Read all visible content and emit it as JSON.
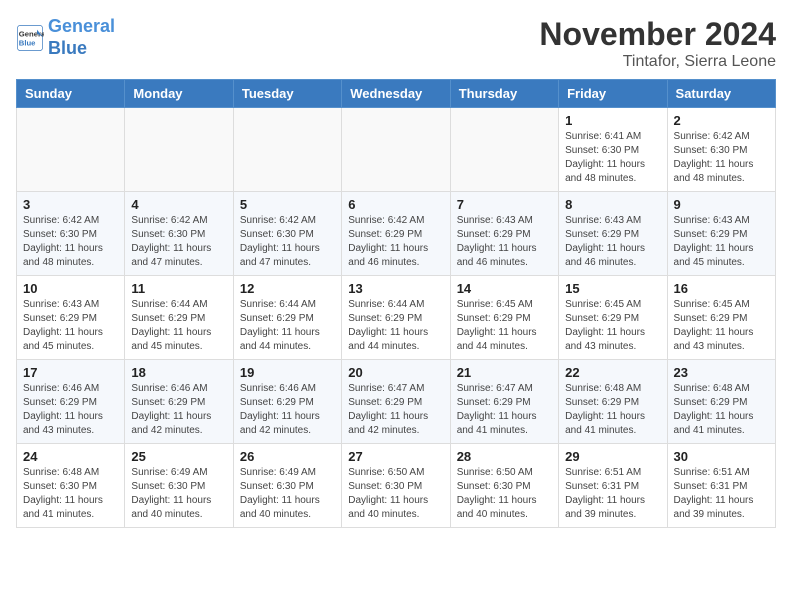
{
  "header": {
    "logo_line1": "General",
    "logo_line2": "Blue",
    "month_title": "November 2024",
    "location": "Tintafor, Sierra Leone"
  },
  "weekdays": [
    "Sunday",
    "Monday",
    "Tuesday",
    "Wednesday",
    "Thursday",
    "Friday",
    "Saturday"
  ],
  "weeks": [
    [
      {
        "day": "",
        "info": ""
      },
      {
        "day": "",
        "info": ""
      },
      {
        "day": "",
        "info": ""
      },
      {
        "day": "",
        "info": ""
      },
      {
        "day": "",
        "info": ""
      },
      {
        "day": "1",
        "info": "Sunrise: 6:41 AM\nSunset: 6:30 PM\nDaylight: 11 hours and 48 minutes."
      },
      {
        "day": "2",
        "info": "Sunrise: 6:42 AM\nSunset: 6:30 PM\nDaylight: 11 hours and 48 minutes."
      }
    ],
    [
      {
        "day": "3",
        "info": "Sunrise: 6:42 AM\nSunset: 6:30 PM\nDaylight: 11 hours and 48 minutes."
      },
      {
        "day": "4",
        "info": "Sunrise: 6:42 AM\nSunset: 6:30 PM\nDaylight: 11 hours and 47 minutes."
      },
      {
        "day": "5",
        "info": "Sunrise: 6:42 AM\nSunset: 6:30 PM\nDaylight: 11 hours and 47 minutes."
      },
      {
        "day": "6",
        "info": "Sunrise: 6:42 AM\nSunset: 6:29 PM\nDaylight: 11 hours and 46 minutes."
      },
      {
        "day": "7",
        "info": "Sunrise: 6:43 AM\nSunset: 6:29 PM\nDaylight: 11 hours and 46 minutes."
      },
      {
        "day": "8",
        "info": "Sunrise: 6:43 AM\nSunset: 6:29 PM\nDaylight: 11 hours and 46 minutes."
      },
      {
        "day": "9",
        "info": "Sunrise: 6:43 AM\nSunset: 6:29 PM\nDaylight: 11 hours and 45 minutes."
      }
    ],
    [
      {
        "day": "10",
        "info": "Sunrise: 6:43 AM\nSunset: 6:29 PM\nDaylight: 11 hours and 45 minutes."
      },
      {
        "day": "11",
        "info": "Sunrise: 6:44 AM\nSunset: 6:29 PM\nDaylight: 11 hours and 45 minutes."
      },
      {
        "day": "12",
        "info": "Sunrise: 6:44 AM\nSunset: 6:29 PM\nDaylight: 11 hours and 44 minutes."
      },
      {
        "day": "13",
        "info": "Sunrise: 6:44 AM\nSunset: 6:29 PM\nDaylight: 11 hours and 44 minutes."
      },
      {
        "day": "14",
        "info": "Sunrise: 6:45 AM\nSunset: 6:29 PM\nDaylight: 11 hours and 44 minutes."
      },
      {
        "day": "15",
        "info": "Sunrise: 6:45 AM\nSunset: 6:29 PM\nDaylight: 11 hours and 43 minutes."
      },
      {
        "day": "16",
        "info": "Sunrise: 6:45 AM\nSunset: 6:29 PM\nDaylight: 11 hours and 43 minutes."
      }
    ],
    [
      {
        "day": "17",
        "info": "Sunrise: 6:46 AM\nSunset: 6:29 PM\nDaylight: 11 hours and 43 minutes."
      },
      {
        "day": "18",
        "info": "Sunrise: 6:46 AM\nSunset: 6:29 PM\nDaylight: 11 hours and 42 minutes."
      },
      {
        "day": "19",
        "info": "Sunrise: 6:46 AM\nSunset: 6:29 PM\nDaylight: 11 hours and 42 minutes."
      },
      {
        "day": "20",
        "info": "Sunrise: 6:47 AM\nSunset: 6:29 PM\nDaylight: 11 hours and 42 minutes."
      },
      {
        "day": "21",
        "info": "Sunrise: 6:47 AM\nSunset: 6:29 PM\nDaylight: 11 hours and 41 minutes."
      },
      {
        "day": "22",
        "info": "Sunrise: 6:48 AM\nSunset: 6:29 PM\nDaylight: 11 hours and 41 minutes."
      },
      {
        "day": "23",
        "info": "Sunrise: 6:48 AM\nSunset: 6:29 PM\nDaylight: 11 hours and 41 minutes."
      }
    ],
    [
      {
        "day": "24",
        "info": "Sunrise: 6:48 AM\nSunset: 6:30 PM\nDaylight: 11 hours and 41 minutes."
      },
      {
        "day": "25",
        "info": "Sunrise: 6:49 AM\nSunset: 6:30 PM\nDaylight: 11 hours and 40 minutes."
      },
      {
        "day": "26",
        "info": "Sunrise: 6:49 AM\nSunset: 6:30 PM\nDaylight: 11 hours and 40 minutes."
      },
      {
        "day": "27",
        "info": "Sunrise: 6:50 AM\nSunset: 6:30 PM\nDaylight: 11 hours and 40 minutes."
      },
      {
        "day": "28",
        "info": "Sunrise: 6:50 AM\nSunset: 6:30 PM\nDaylight: 11 hours and 40 minutes."
      },
      {
        "day": "29",
        "info": "Sunrise: 6:51 AM\nSunset: 6:31 PM\nDaylight: 11 hours and 39 minutes."
      },
      {
        "day": "30",
        "info": "Sunrise: 6:51 AM\nSunset: 6:31 PM\nDaylight: 11 hours and 39 minutes."
      }
    ]
  ]
}
